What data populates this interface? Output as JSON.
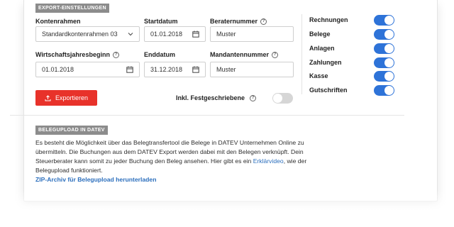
{
  "export_section": {
    "tag": "EXPORT-EINSTELLUNGEN",
    "fields": {
      "kontenrahmen": {
        "label": "Kontenrahmen",
        "value": "Standardkontenrahmen 03"
      },
      "startdatum": {
        "label": "Startdatum",
        "value": "01.01.2018"
      },
      "beraternummer": {
        "label": "Beraternummer",
        "value": "Muster"
      },
      "wirtschaftsjahresbeginn": {
        "label": "Wirtschaftsjahresbeginn",
        "value": "01.01.2018"
      },
      "enddatum": {
        "label": "Enddatum",
        "value": "31.12.2018"
      },
      "mandantennummer": {
        "label": "Mandantennummer",
        "value": "Muster"
      }
    },
    "export_button": "Exportieren",
    "festgeschriebene": {
      "label": "Inkl. Festgeschriebene",
      "on": false
    },
    "toggles": [
      {
        "label": "Rechnungen",
        "on": true
      },
      {
        "label": "Belege",
        "on": true
      },
      {
        "label": "Anlagen",
        "on": true
      },
      {
        "label": "Zahlungen",
        "on": true
      },
      {
        "label": "Kasse",
        "on": true
      },
      {
        "label": "Gutschriften",
        "on": true
      }
    ]
  },
  "upload_section": {
    "tag": "BELEGUPLOAD IN DATEV",
    "text_before_link": "Es besteht die Möglichkeit über das Belegtransfertool die Belege in DATEV Unternehmen Online zu übermitteln. Die Buchungen aus dem DATEV Export werden dabei mit den Belegen verknüpft. Dein Steuerberater kann somit zu jeder Buchung den Beleg ansehen. Hier gibt es ein ",
    "link_text": "Erklärvideo",
    "text_after_link": ", wie der Belegupload funktioniert.",
    "zip_link": "ZIP-Archiv für Belegupload herunterladen"
  },
  "colors": {
    "toggle_on": "#2e73d8",
    "export_button": "#e8322a",
    "link": "#2c6fbd",
    "tag_background": "#8c8c8c"
  },
  "icons": {
    "date_fields": "calendar-icon",
    "select": "chevron-down-icon",
    "help": "help-icon",
    "export_button": "upload-icon"
  }
}
